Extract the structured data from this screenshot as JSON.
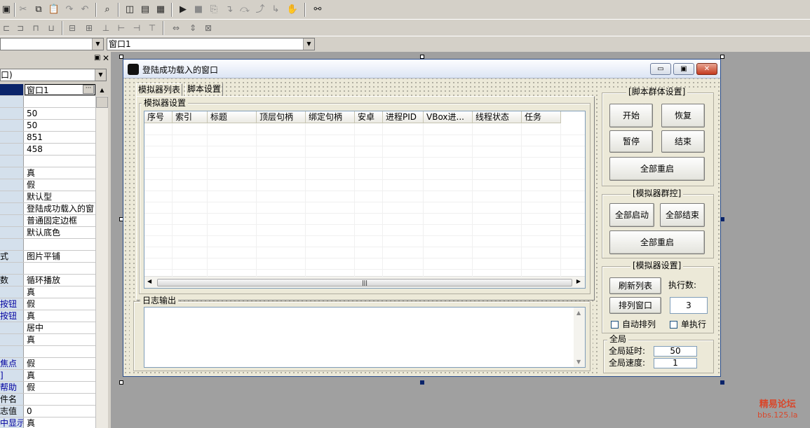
{
  "toolbar": {
    "combo_left_value": "",
    "combo_right_value": "窗口1"
  },
  "property_panel": {
    "object_selector": "口)",
    "rows": [
      {
        "key": "",
        "value": "窗口1",
        "selected": true
      },
      {
        "key": "",
        "value": ""
      },
      {
        "key": "",
        "value": "50"
      },
      {
        "key": "",
        "value": "50"
      },
      {
        "key": "",
        "value": "851"
      },
      {
        "key": "",
        "value": "458"
      },
      {
        "key": "",
        "value": ""
      },
      {
        "key": "",
        "value": "真"
      },
      {
        "key": "",
        "value": "假"
      },
      {
        "key": "",
        "value": "默认型"
      },
      {
        "key": "",
        "value": "登陆成功载入的窗"
      },
      {
        "key": "",
        "value": "普通固定边框"
      },
      {
        "key": "",
        "value": "默认底色"
      },
      {
        "key": "",
        "value": ""
      },
      {
        "key": "式",
        "value": "图片平铺"
      },
      {
        "key": "",
        "value": ""
      },
      {
        "key": "数",
        "value": "循环播放"
      },
      {
        "key": "",
        "value": "真"
      },
      {
        "key": "按钮",
        "value": "假",
        "blue": true
      },
      {
        "key": "按钮",
        "value": "真",
        "blue": true
      },
      {
        "key": "",
        "value": "居中"
      },
      {
        "key": "",
        "value": "真"
      },
      {
        "key": "",
        "value": ""
      },
      {
        "key": "焦点",
        "value": "假",
        "blue": true
      },
      {
        "key": "]",
        "value": "真",
        "blue": true
      },
      {
        "key": "帮助",
        "value": "假",
        "blue": true
      },
      {
        "key": "件名",
        "value": ""
      },
      {
        "key": "志值",
        "value": "0"
      },
      {
        "key": "中显示",
        "value": "真",
        "blue": true
      }
    ]
  },
  "window": {
    "title": "登陆成功载入的窗口",
    "tabs": [
      {
        "label": "模拟器列表",
        "active": true
      },
      {
        "label": "脚本设置",
        "active": false
      }
    ],
    "emu_group_label": "模拟器设置",
    "columns": [
      "序号",
      "索引",
      "标题",
      "顶层句柄",
      "绑定句柄",
      "安卓",
      "进程PID",
      "VBox进...",
      "线程状态",
      "任务"
    ],
    "log_group_label": "日志输出",
    "script_group": {
      "label": "[脚本群体设置]",
      "start": "开始",
      "resume": "恢复",
      "pause": "暂停",
      "end": "结束",
      "restart_all": "全部重启"
    },
    "emu_control_group": {
      "label": "[模拟器群控]",
      "start_all": "全部启动",
      "end_all": "全部结束",
      "restart_all": "全部重启"
    },
    "emu_setting_group": {
      "label": "[模拟器设置]",
      "refresh_list": "刷新列表",
      "exec_count_label": "执行数:",
      "arrange_window": "排列窗口",
      "exec_count_value": "3",
      "auto_arrange": "自动排列",
      "single_exec": "单执行"
    },
    "global_group": {
      "label": "全局",
      "delay_label": "全局延时:",
      "delay_value": "50",
      "speed_label": "全局速度:",
      "speed_value": "1"
    }
  },
  "watermark": {
    "line1": "精易论坛",
    "line2": "bbs.125.la"
  }
}
